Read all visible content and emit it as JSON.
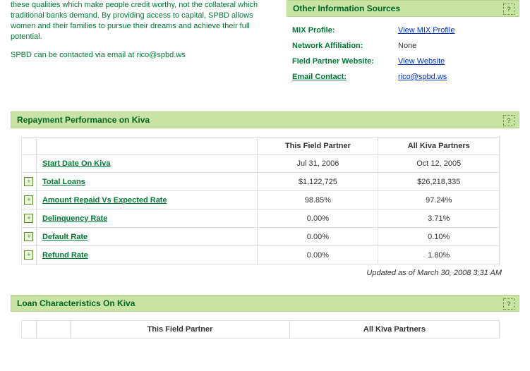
{
  "intro": {
    "para1": "these qualities which make people credit worthy, not the collateral which traditional banks demand. By providing access to capital, SPBD allows women and their families to pursue their dreams and achieve their full potential.",
    "para2": "SPBD can be contacted via email at rico@spbd.ws"
  },
  "other_info": {
    "header": "Other Information Sources",
    "rows": {
      "mix_label": "MIX Profile:",
      "mix_val": "View MIX Profile",
      "net_label": "Network Affiliation:",
      "net_val": "None",
      "web_label": "Field Partner Website:",
      "web_val": "View Website",
      "email_label": "Email Contact:",
      "email_val": "rico@spbd.ws"
    }
  },
  "repayment": {
    "header": "Repayment Performance on Kiva",
    "col_partner": "This Field Partner",
    "col_all": "All Kiva Partners",
    "rows": [
      {
        "label": "Start Date On Kiva",
        "partner": "Jul 31, 2006",
        "all": "Oct 12, 2005",
        "expand": false
      },
      {
        "label": "Total Loans",
        "partner": "$1,122,725",
        "all": "$26,218,335",
        "expand": true
      },
      {
        "label": "Amount Repaid Vs Expected Rate",
        "partner": "98.85%",
        "all": "97.24%",
        "expand": true
      },
      {
        "label": "Delinquency Rate",
        "partner": "0.00%",
        "all": "3.71%",
        "expand": true
      },
      {
        "label": "Default Rate",
        "partner": "0.00%",
        "all": "0.10%",
        "expand": true
      },
      {
        "label": "Refund Rate",
        "partner": "0.00%",
        "all": "1.80%",
        "expand": true
      }
    ],
    "updated": "Updated as of March 30, 2008 3:31 AM"
  },
  "loan_char": {
    "header": "Loan Characteristics On Kiva",
    "col_partner": "This Field Partner",
    "col_all": "All Kiva Partners"
  }
}
